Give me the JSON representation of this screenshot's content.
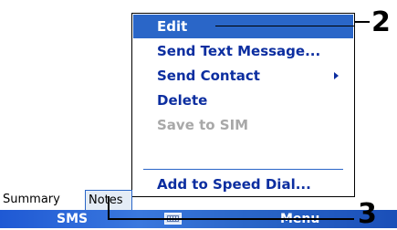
{
  "menu": {
    "items": [
      {
        "label": "Edit",
        "state": "selected"
      },
      {
        "label": "Send Text Message...",
        "state": "normal"
      },
      {
        "label": "Send Contact",
        "state": "normal",
        "has_submenu": true
      },
      {
        "label": "Delete",
        "state": "normal"
      },
      {
        "label": "Save to SIM",
        "state": "disabled"
      },
      {
        "label": "Add to Speed Dial...",
        "state": "normal"
      }
    ]
  },
  "tabs": [
    {
      "label": "Summary",
      "active": false
    },
    {
      "label": "Notes",
      "active": true
    }
  ],
  "softkeys": {
    "left_label": "SMS",
    "center_icon": "keyboard-icon",
    "right_label": "Menu"
  },
  "callouts": [
    {
      "number": "2"
    },
    {
      "number": "3"
    }
  ],
  "colors": {
    "menu_text": "#0c2ea0",
    "selection": "#2a66c8",
    "disabled_text": "#a8a8a8",
    "softkey_bar": "#2a66c8"
  }
}
